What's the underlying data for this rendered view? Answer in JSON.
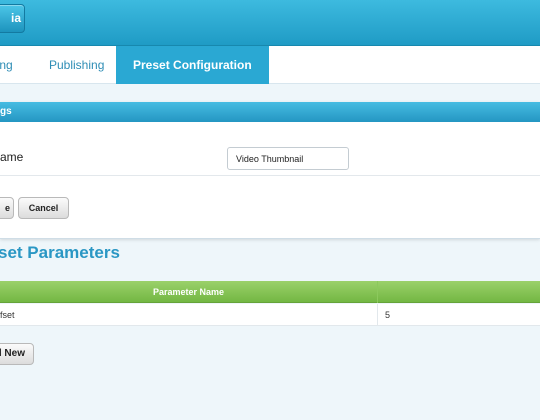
{
  "header": {
    "media_button_label": "ia"
  },
  "tabs": [
    {
      "label": "ling",
      "active": false
    },
    {
      "label": "Publishing",
      "active": false
    },
    {
      "label": "Preset Configuration",
      "active": true
    }
  ],
  "settings_panel": {
    "header_label": "gs",
    "name_label": "ame",
    "name_value": "Video Thumbnail",
    "save_label": "e",
    "cancel_label": "Cancel"
  },
  "parameters": {
    "section_title": "set Parameters",
    "columns": [
      "Parameter Name",
      ""
    ],
    "rows": [
      {
        "name": "fset",
        "value": "5"
      }
    ],
    "add_label": "l New"
  },
  "colors": {
    "header_blue": "#2aa8d3",
    "table_green": "#85c455",
    "title_blue": "#2a97c4"
  }
}
